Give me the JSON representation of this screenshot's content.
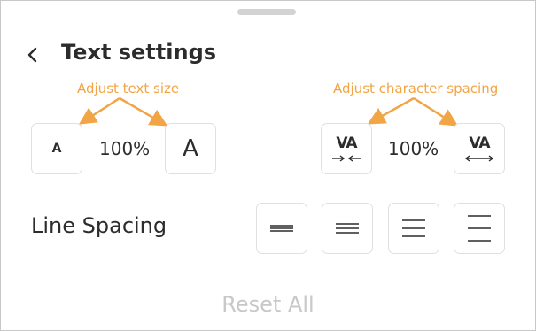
{
  "header": {
    "title": "Text settings",
    "back_icon": "chevron-left-icon"
  },
  "annotations": {
    "text_size": "Adjust text size",
    "char_spacing": "Adjust character spacing",
    "color": "#f2a545"
  },
  "text_size": {
    "decrease_glyph": "A",
    "value": "100%",
    "increase_glyph": "A"
  },
  "char_spacing": {
    "decrease_glyph": "VA",
    "decrease_icon": "arrows-inward-icon",
    "value": "100%",
    "increase_glyph": "VA",
    "increase_icon": "arrows-outward-icon"
  },
  "line_spacing": {
    "label": "Line Spacing",
    "options": [
      {
        "icon": "line-spacing-tight-icon"
      },
      {
        "icon": "line-spacing-normal-icon"
      },
      {
        "icon": "line-spacing-wide-icon"
      },
      {
        "icon": "line-spacing-widest-icon"
      }
    ]
  },
  "footer": {
    "reset_label": "Reset All"
  },
  "colors": {
    "text": "#2c2c2c",
    "border": "#e0e0e0",
    "disabled": "#c8c8c8"
  }
}
